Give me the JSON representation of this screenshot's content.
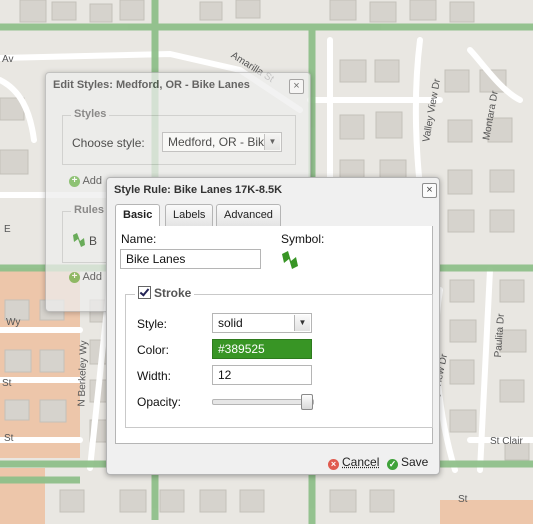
{
  "map": {
    "labels": {
      "av": "Av",
      "amarilla_st": "Amarilla St",
      "valley_view_dr_top": "Valley View Dr",
      "montara_dr": "Montara Dr",
      "wy_left": "Wy",
      "n_berkeley_wy": "N Berkeley Wy",
      "st_left_1": "St",
      "st_left_2": "St",
      "e_left": "E",
      "paulita_dr": "Paulita Dr",
      "valley_view_dr_bottom": "Valley View Dr",
      "st_clair": "St Clair",
      "st_right": "St"
    },
    "colors": {
      "background": "#e9e7e2",
      "green_road": "#8fc08a",
      "orange_area": "#e9b48f"
    }
  },
  "edit_styles": {
    "title": "Edit Styles: Medford, OR - Bike Lanes",
    "close_icon": "×",
    "styles_legend": "Styles",
    "choose_style_label": "Choose style:",
    "choose_style_value": "Medford, OR - Bik",
    "add_label_1": "Add",
    "rules_legend": "Rules",
    "rule_letter": "B",
    "add_label_2": "Add"
  },
  "style_rule": {
    "title": "Style Rule: Bike Lanes 17K-8.5K",
    "close_icon": "×",
    "tabs": [
      {
        "label": "Basic",
        "active": true
      },
      {
        "label": "Labels",
        "active": false
      },
      {
        "label": "Advanced",
        "active": false
      }
    ],
    "name_label": "Name:",
    "name_value": "Bike Lanes",
    "symbol_label": "Symbol:",
    "symbol_color": "#389525",
    "stroke_legend": "Stroke",
    "stroke_checked": true,
    "style_label": "Style:",
    "style_value": "solid",
    "color_label": "Color:",
    "color_value": "#389525",
    "width_label": "Width:",
    "width_value": "12",
    "opacity_label": "Opacity:",
    "opacity_fraction": 1.0,
    "cancel_label": "Cancel",
    "save_label": "Save"
  }
}
